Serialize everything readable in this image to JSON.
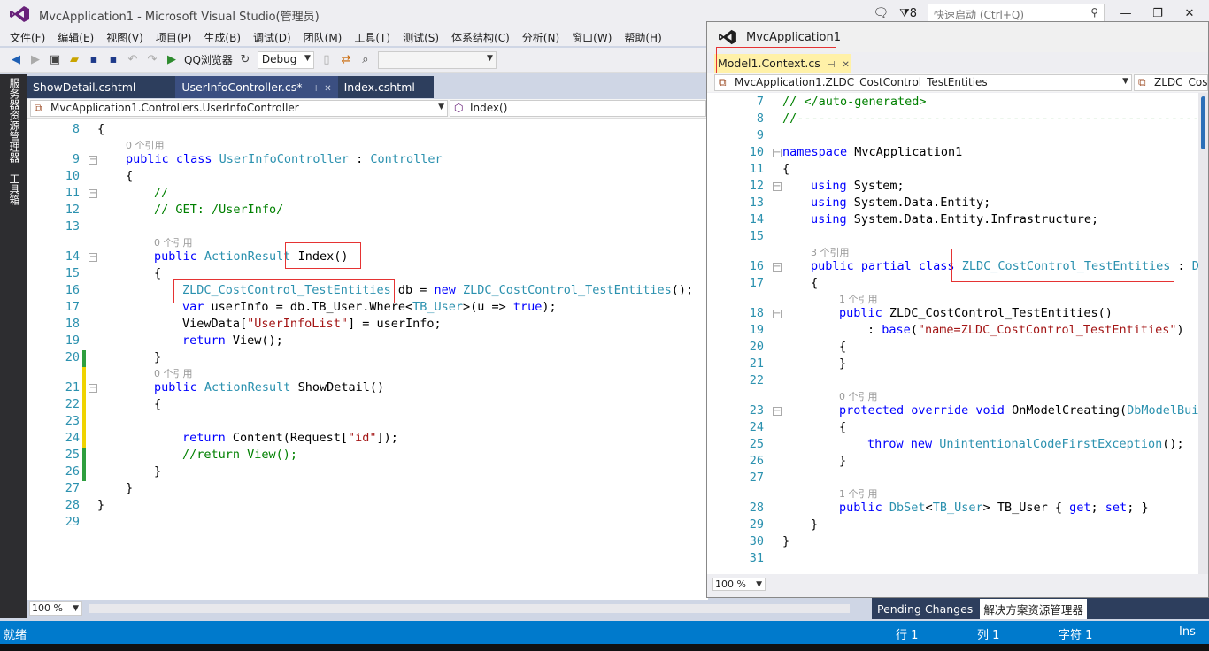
{
  "window": {
    "title": "MvcApplication1 - Microsoft Visual Studio(管理员)",
    "notification_count": "8",
    "quick_launch_placeholder": "快速启动 (Ctrl+Q)"
  },
  "menu": [
    "文件(F)",
    "编辑(E)",
    "视图(V)",
    "项目(P)",
    "生成(B)",
    "调试(D)",
    "团队(M)",
    "工具(T)",
    "测试(S)",
    "体系结构(C)",
    "分析(N)",
    "窗口(W)",
    "帮助(H)"
  ],
  "toolbar": {
    "browser_label": "QQ浏览器",
    "config": "Debug"
  },
  "side_tabs": [
    "服务器资源管理器",
    "工具箱"
  ],
  "left_editor": {
    "tabs": [
      {
        "label": "ShowDetail.cshtml",
        "active": false
      },
      {
        "label": "UserInfoController.cs*",
        "active": true
      },
      {
        "label": "Index.cshtml",
        "active": false
      }
    ],
    "nav_class": "MvcApplication1.Controllers.UserInfoController",
    "nav_member": "Index()",
    "zoom": "100 %",
    "lines": [
      {
        "n": "8",
        "c": "{"
      },
      {
        "n": "9",
        "c": "public class UserInfoController : Controller",
        "ref": "0 个引用"
      },
      {
        "n": "10",
        "c": "{"
      },
      {
        "n": "11",
        "c": "//"
      },
      {
        "n": "12",
        "c": "// GET: /UserInfo/"
      },
      {
        "n": "13",
        "c": ""
      },
      {
        "n": "14",
        "c": "public ActionResult Index()",
        "ref": "0 个引用"
      },
      {
        "n": "15",
        "c": "{"
      },
      {
        "n": "16",
        "c": "ZLDC_CostControl_TestEntities db = new ZLDC_CostControl_TestEntities();"
      },
      {
        "n": "17",
        "c": "var userInfo = db.TB_User.Where<TB_User>(u => true);"
      },
      {
        "n": "18",
        "c": "ViewData[\"UserInfoList\"] = userInfo;"
      },
      {
        "n": "19",
        "c": "return View();"
      },
      {
        "n": "20",
        "c": "}"
      },
      {
        "n": "21",
        "c": "public ActionResult ShowDetail()",
        "ref": "0 个引用"
      },
      {
        "n": "22",
        "c": "{"
      },
      {
        "n": "23",
        "c": ""
      },
      {
        "n": "24",
        "c": "return Content(Request[\"id\"]);"
      },
      {
        "n": "25",
        "c": "//return View();"
      },
      {
        "n": "26",
        "c": "}"
      },
      {
        "n": "27",
        "c": "}"
      },
      {
        "n": "28",
        "c": "}"
      },
      {
        "n": "29",
        "c": ""
      }
    ]
  },
  "float_window": {
    "title": "MvcApplication1",
    "tab": "Model1.Context.cs",
    "nav_class": "MvcApplication1.ZLDC_CostControl_TestEntities",
    "nav_member": "ZLDC_CostC",
    "zoom": "100 %",
    "lines": [
      {
        "n": "7",
        "c": "// </auto-generated>"
      },
      {
        "n": "8",
        "c": "//------------------------------------------------------------------------------"
      },
      {
        "n": "9",
        "c": ""
      },
      {
        "n": "10",
        "c": "namespace MvcApplication1"
      },
      {
        "n": "11",
        "c": "{"
      },
      {
        "n": "12",
        "c": "using System;"
      },
      {
        "n": "13",
        "c": "using System.Data.Entity;"
      },
      {
        "n": "14",
        "c": "using System.Data.Entity.Infrastructure;"
      },
      {
        "n": "15",
        "c": ""
      },
      {
        "n": "16",
        "c": "public partial class ZLDC_CostControl_TestEntities : DbCo",
        "ref": "3 个引用"
      },
      {
        "n": "17",
        "c": "{"
      },
      {
        "n": "18",
        "c": "public ZLDC_CostControl_TestEntities()",
        "ref": "1 个引用"
      },
      {
        "n": "19",
        "c": ": base(\"name=ZLDC_CostControl_TestEntities\")"
      },
      {
        "n": "20",
        "c": "{"
      },
      {
        "n": "21",
        "c": "}"
      },
      {
        "n": "22",
        "c": ""
      },
      {
        "n": "23",
        "c": "protected override void OnModelCreating(DbModelBuilde",
        "ref": "0 个引用"
      },
      {
        "n": "24",
        "c": "{"
      },
      {
        "n": "25",
        "c": "throw new UnintentionalCodeFirstException();"
      },
      {
        "n": "26",
        "c": "}"
      },
      {
        "n": "27",
        "c": ""
      },
      {
        "n": "28",
        "c": "public DbSet<TB_User> TB_User { get; set; }",
        "ref": "1 个引用"
      },
      {
        "n": "29",
        "c": "}"
      },
      {
        "n": "30",
        "c": "}"
      },
      {
        "n": "31",
        "c": ""
      }
    ]
  },
  "bottom_tabs": [
    "Pending Changes",
    "解决方案资源管理器"
  ],
  "status": {
    "ready": "就绪",
    "row": "行 1",
    "col": "列 1",
    "char": "字符 1",
    "mode": "Ins"
  },
  "colors": {
    "accent": "#007acc",
    "keyword": "#0000ff",
    "type": "#2b91af",
    "string": "#a31515",
    "comment": "#008000",
    "highlight_box": "#e53333"
  }
}
